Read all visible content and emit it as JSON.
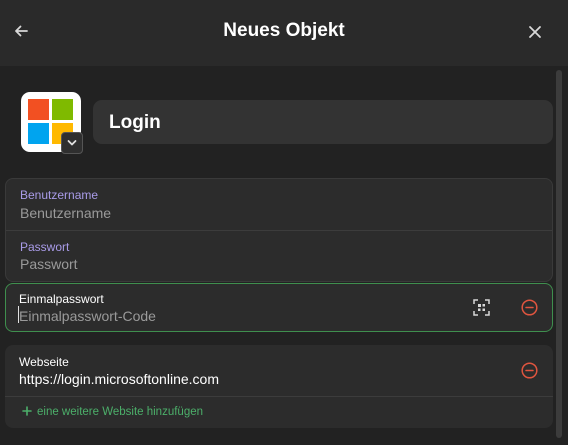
{
  "header": {
    "title": "Neues Objekt",
    "back_icon": "arrow-left-icon",
    "close_icon": "close-icon"
  },
  "item": {
    "logo_icon": "microsoft-logo",
    "title": "Login"
  },
  "fields": {
    "username": {
      "label": "Benutzername",
      "placeholder": "Benutzername"
    },
    "password": {
      "label": "Passwort",
      "placeholder": "Passwort"
    },
    "otp": {
      "label": "Einmalpasswort",
      "placeholder": "Einmalpasswort-Code"
    },
    "website": {
      "label": "Webseite",
      "value": "https://login.microsoftonline.com"
    }
  },
  "add_website": "eine weitere Website hinzufügen",
  "colors": {
    "accent_label": "#a99be8",
    "focus_border": "#3f8f4e",
    "remove_red": "#e0553f",
    "add_green": "#4caf6a"
  }
}
